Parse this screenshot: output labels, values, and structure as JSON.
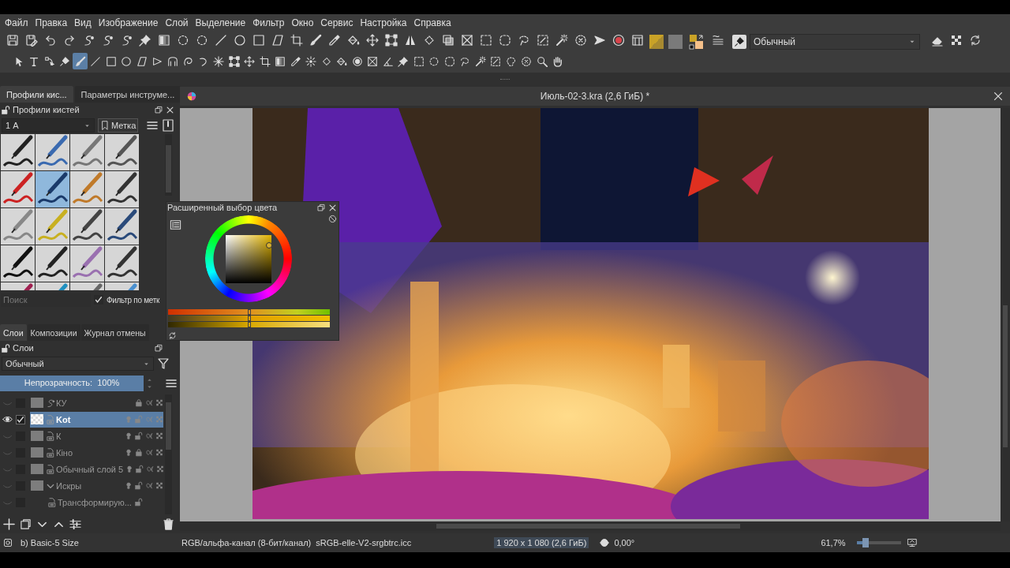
{
  "menu": [
    "Файл",
    "Правка",
    "Вид",
    "Изображение",
    "Слой",
    "Выделение",
    "Фильтр",
    "Окно",
    "Сервис",
    "Настройка",
    "Справка"
  ],
  "toolbar": {
    "blend_mode": "Обычный"
  },
  "toolbox": [
    {
      "kind": "pointer",
      "selected": false
    },
    {
      "kind": "text",
      "selected": false
    },
    {
      "kind": "shape-edit",
      "selected": false
    },
    {
      "kind": "calligraphy",
      "selected": false
    },
    {
      "kind": "brush",
      "selected": true
    },
    {
      "kind": "line",
      "selected": false
    },
    {
      "kind": "rectangle",
      "selected": false
    },
    {
      "kind": "ellipse",
      "selected": false
    },
    {
      "kind": "polygon",
      "selected": false
    },
    {
      "kind": "polyline",
      "selected": false
    },
    {
      "kind": "bezier",
      "selected": false
    },
    {
      "kind": "freehand-path",
      "selected": false
    },
    {
      "kind": "dynamic-brush",
      "selected": false
    },
    {
      "kind": "multibrush",
      "selected": false
    },
    {
      "kind": "transform",
      "selected": false
    },
    {
      "kind": "move",
      "selected": false
    },
    {
      "kind": "crop",
      "selected": false
    },
    {
      "kind": "gradient",
      "selected": false
    },
    {
      "kind": "eyedropper",
      "selected": false
    },
    {
      "kind": "colorize",
      "selected": false
    },
    {
      "kind": "smart-patch",
      "selected": false
    },
    {
      "kind": "fill",
      "selected": false
    },
    {
      "kind": "enclosed-fill",
      "selected": false
    },
    {
      "kind": "assistant",
      "selected": false
    },
    {
      "kind": "measure",
      "selected": false
    },
    {
      "kind": "reference",
      "selected": false
    },
    {
      "kind": "rect-select",
      "selected": false
    },
    {
      "kind": "ellipse-select",
      "selected": false
    },
    {
      "kind": "polygon-select",
      "selected": false
    },
    {
      "kind": "freehand-select",
      "selected": false
    },
    {
      "kind": "contiguous-select",
      "selected": false
    },
    {
      "kind": "similar-select",
      "selected": false
    },
    {
      "kind": "bezier-select",
      "selected": false
    },
    {
      "kind": "magnetic-select",
      "selected": false
    },
    {
      "kind": "zoom",
      "selected": false
    },
    {
      "kind": "pan",
      "selected": false
    }
  ],
  "brush_docker": {
    "tabs": [
      {
        "label": "Профили кис...",
        "selected": true
      },
      {
        "label": "Параметры инструме...",
        "selected": false
      }
    ],
    "title": "Профили кистей",
    "preset_set": "1 А",
    "tag_button": "Метка",
    "presets": [
      {
        "selected": false
      },
      {
        "selected": false
      },
      {
        "selected": false
      },
      {
        "selected": false
      },
      {
        "selected": false
      },
      {
        "selected": true
      },
      {
        "selected": false
      },
      {
        "selected": false
      },
      {
        "selected": false
      },
      {
        "selected": false
      },
      {
        "selected": false
      },
      {
        "selected": false
      },
      {
        "selected": false
      },
      {
        "selected": false
      },
      {
        "selected": false
      },
      {
        "selected": false
      },
      {
        "selected": false
      },
      {
        "selected": false
      },
      {
        "selected": false
      },
      {
        "selected": false
      }
    ],
    "search": {
      "placeholder": "Поиск"
    },
    "filter": {
      "label": "Фильтр по метк",
      "checked": true
    }
  },
  "layers_docker": {
    "tabs": [
      {
        "label": "Слои",
        "selected": true
      },
      {
        "label": "Композиции",
        "selected": false
      },
      {
        "label": "Журнал отмены",
        "selected": false
      }
    ],
    "title": "Слои",
    "blend_mode": "Обычный",
    "opacity": {
      "text": "Непрозрачность:  100%",
      "level": 1
    },
    "layers": [
      {
        "name": "КУ",
        "kind": "vector",
        "selected": false,
        "visible": false,
        "locked": true
      },
      {
        "name": "Kot",
        "kind": "paint",
        "selected": true,
        "visible": true,
        "locked": false
      },
      {
        "name": "К",
        "kind": "paint",
        "selected": false,
        "visible": false,
        "locked": false
      },
      {
        "name": "Кіно",
        "kind": "paint",
        "selected": false,
        "visible": false,
        "locked": true
      },
      {
        "name": "Обычный слой 5",
        "kind": "paint",
        "selected": false,
        "visible": false,
        "locked": false
      },
      {
        "name": "Искры",
        "kind": "group",
        "selected": false,
        "visible": false,
        "locked": false,
        "expanded": true,
        "children": [
          {
            "name": "Трансформирую...",
            "kind": "transform",
            "selected": false,
            "visible": false,
            "locked": false
          }
        ]
      }
    ]
  },
  "color_selector": {
    "title": "Расширенный выбор цвета",
    "sliders": [
      {
        "level": 0.5
      },
      {
        "level": 0.5
      },
      {
        "level": 0.5
      }
    ]
  },
  "document": {
    "title": "Июль-02-3.kra (2,6 ГиБ) *"
  },
  "status_bar": {
    "brush": "b) Basic-5 Size",
    "color_space": "RGB/альфа-канал (8-бит/канал)",
    "profile": "sRGB-elle-V2-srgbtrc.icc",
    "size": "1 920 x 1 080 (2,6 ГиБ)",
    "rotation": "0,00°",
    "zoom": "61,7%",
    "zoom_slider": {
      "level": 0.2
    }
  }
}
